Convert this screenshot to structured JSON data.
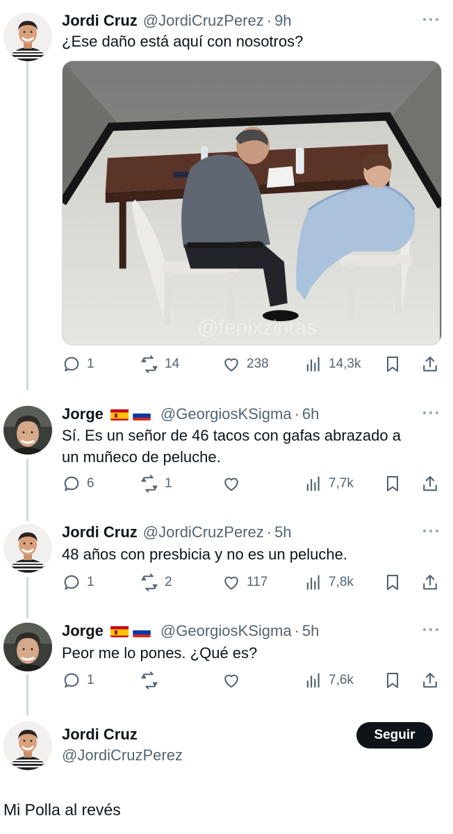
{
  "tweets": [
    {
      "name": "Jordi Cruz",
      "handle": "@JordiCruzPerez",
      "time": "9h",
      "text": "¿Ese daño está aquí con nosotros?",
      "avatar": "jordi-avatar",
      "media": {
        "watermark": "@fenixzintas"
      },
      "stats": {
        "replies": "1",
        "retweets": "14",
        "likes": "238",
        "views": "14,3k"
      }
    },
    {
      "name": "Jorge",
      "flags": [
        "spain-flag",
        "russia-flag"
      ],
      "handle": "@GeorgiosKSigma",
      "time": "6h",
      "text_lines": [
        "Sí. Es un señor de 46 tacos con gafas abrazado a",
        "un muñeco de peluche."
      ],
      "avatar": "jorge-avatar",
      "stats": {
        "replies": "6",
        "retweets": "1",
        "likes": "",
        "views": "7,7k"
      }
    },
    {
      "name": "Jordi Cruz",
      "handle": "@JordiCruzPerez",
      "time": "5h",
      "text": "48 años con presbicia y no es un peluche.",
      "avatar": "jordi-avatar",
      "stats": {
        "replies": "1",
        "retweets": "2",
        "likes": "117",
        "views": "7,8k"
      }
    },
    {
      "name": "Jorge",
      "flags": [
        "spain-flag",
        "russia-flag"
      ],
      "handle": "@GeorgiosKSigma",
      "time": "5h",
      "text": "Peor me lo pones. ¿Qué es?",
      "avatar": "jorge-avatar",
      "stats": {
        "replies": "1",
        "retweets": "",
        "likes": "",
        "views": "7,6k"
      }
    }
  ],
  "author": {
    "name": "Jordi Cruz",
    "handle": "@JordiCruzPerez",
    "follow_label": "Seguir"
  },
  "caption": "Mi Polla al revés",
  "colors": {
    "text": "#0f1419",
    "secondary": "#536471",
    "line": "#cfd9de",
    "button": "#0f1419"
  }
}
